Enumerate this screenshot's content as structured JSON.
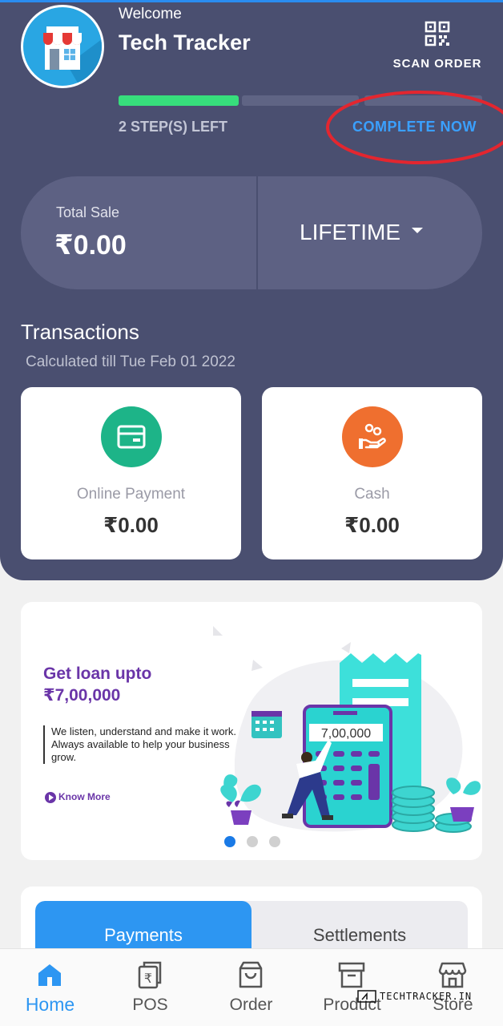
{
  "header": {
    "welcome": "Welcome",
    "shop_name": "Tech Tracker",
    "scan_label": "SCAN ORDER",
    "steps_left": "2 STEP(S) LEFT",
    "complete_now": "COMPLETE NOW",
    "progress_fraction": 0.33
  },
  "sale": {
    "label": "Total Sale",
    "value": "₹0.00",
    "period": "LIFETIME"
  },
  "transactions": {
    "title": "Transactions",
    "subtitle": "Calculated till Tue Feb 01 2022",
    "cards": [
      {
        "label": "Online Payment",
        "value": "₹0.00",
        "icon": "card-icon",
        "color": "#1db488"
      },
      {
        "label": "Cash",
        "value": "₹0.00",
        "icon": "cash-hand-icon",
        "color": "#ef6f2f"
      }
    ]
  },
  "banner": {
    "title": "Get loan upto",
    "amount": "₹7,00,000",
    "description": "We listen, understand and make it work. Always available to help your business grow.",
    "know_more": "Know More",
    "illustration_amount": "7,00,000",
    "active_slide": 1,
    "slides": 3
  },
  "tabs": [
    "Payments",
    "Settlements"
  ],
  "bottom_nav": [
    {
      "label": "Home",
      "icon": "home-icon",
      "active": true
    },
    {
      "label": "POS",
      "icon": "pos-icon",
      "active": false
    },
    {
      "label": "Order",
      "icon": "order-bag-icon",
      "active": false
    },
    {
      "label": "Product",
      "icon": "product-box-icon",
      "active": false
    },
    {
      "label": "Store",
      "icon": "store-icon",
      "active": false
    }
  ],
  "watermark": "TECHTRACKER.IN",
  "colors": {
    "panel": "#4a4f70",
    "accent_blue": "#2d96f2",
    "progress_green": "#37de7c",
    "loan_purple": "#6a35a8"
  }
}
